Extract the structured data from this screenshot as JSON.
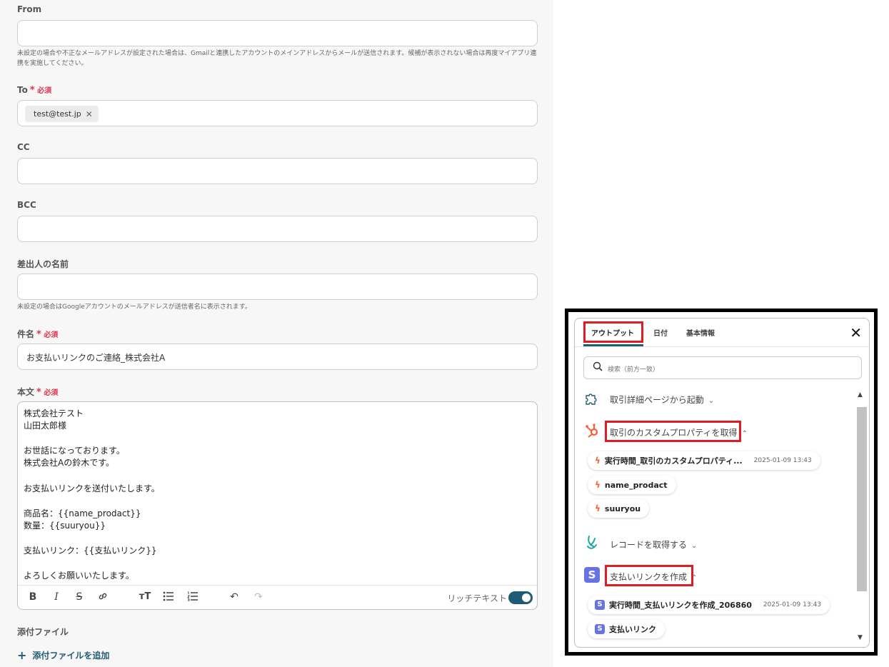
{
  "form": {
    "from": {
      "label": "From",
      "value": "",
      "hint": "未設定の場合や不正なメールアドレスが設定された場合は、Gmailと連携したアカウントのメインアドレスからメールが送信されます。候補が表示されない場合は再度マイアプリ連携を実施してください。"
    },
    "to": {
      "label": "To",
      "required": "必須",
      "chip": "test@test.jp"
    },
    "cc": {
      "label": "CC",
      "value": ""
    },
    "bcc": {
      "label": "BCC",
      "value": ""
    },
    "sender_name": {
      "label": "差出人の名前",
      "value": "",
      "hint": "未設定の場合はGoogleアカウントのメールアドレスが送信者名に表示されます。"
    },
    "subject": {
      "label": "件名",
      "required": "必須",
      "value": "お支払いリンクのご連絡_株式会社A"
    },
    "body": {
      "label": "本文",
      "required": "必須",
      "lines": [
        "株式会社テスト",
        "山田太郎様",
        "",
        "お世話になっております。",
        "株式会社Aの鈴木です。",
        "",
        "お支払いリンクを送付いたします。",
        "",
        "商品名：{{name_prodact}}",
        "数量：{{suuryou}}",
        "",
        "支払いリンク：{{支払いリンク}}",
        "",
        "よろしくお願いいたします。"
      ],
      "rich_text_label": "リッチテキスト"
    },
    "attachments": {
      "label": "添付ファイル",
      "add_label": "添付ファイルを追加"
    }
  },
  "popup": {
    "tabs": [
      "アウトプット",
      "日付",
      "基本情報"
    ],
    "search_placeholder": "検索（前方一致）",
    "sections": [
      {
        "title": "取引詳細ページから起動",
        "icon": "puzzle-icon",
        "expanded": false
      },
      {
        "title": "取引のカスタムプロパティを取得",
        "icon": "hubspot-icon",
        "expanded": true,
        "items": [
          {
            "name": "実行時間_取引のカスタムプロパティ...",
            "timestamp": "2025-01-09 13:43"
          },
          {
            "name": "name_prodact",
            "timestamp": ""
          },
          {
            "name": "suuryou",
            "timestamp": ""
          }
        ]
      },
      {
        "title": "レコードを取得する",
        "icon": "kintone-icon",
        "expanded": false
      },
      {
        "title": "支払いリンクを作成",
        "icon": "stripe-icon",
        "expanded": true,
        "items": [
          {
            "name": "実行時間_支払いリンクを作成_206860",
            "timestamp": "2025-01-09 13:43"
          },
          {
            "name": "支払いリンク",
            "timestamp": ""
          }
        ]
      }
    ],
    "stripe_letter": "S"
  },
  "colors": {
    "accent": "#1f5c73",
    "required": "#e0334d",
    "highlight": "#e11b22",
    "hubspot": "#ff5c35",
    "stripe": "#6772e5"
  }
}
